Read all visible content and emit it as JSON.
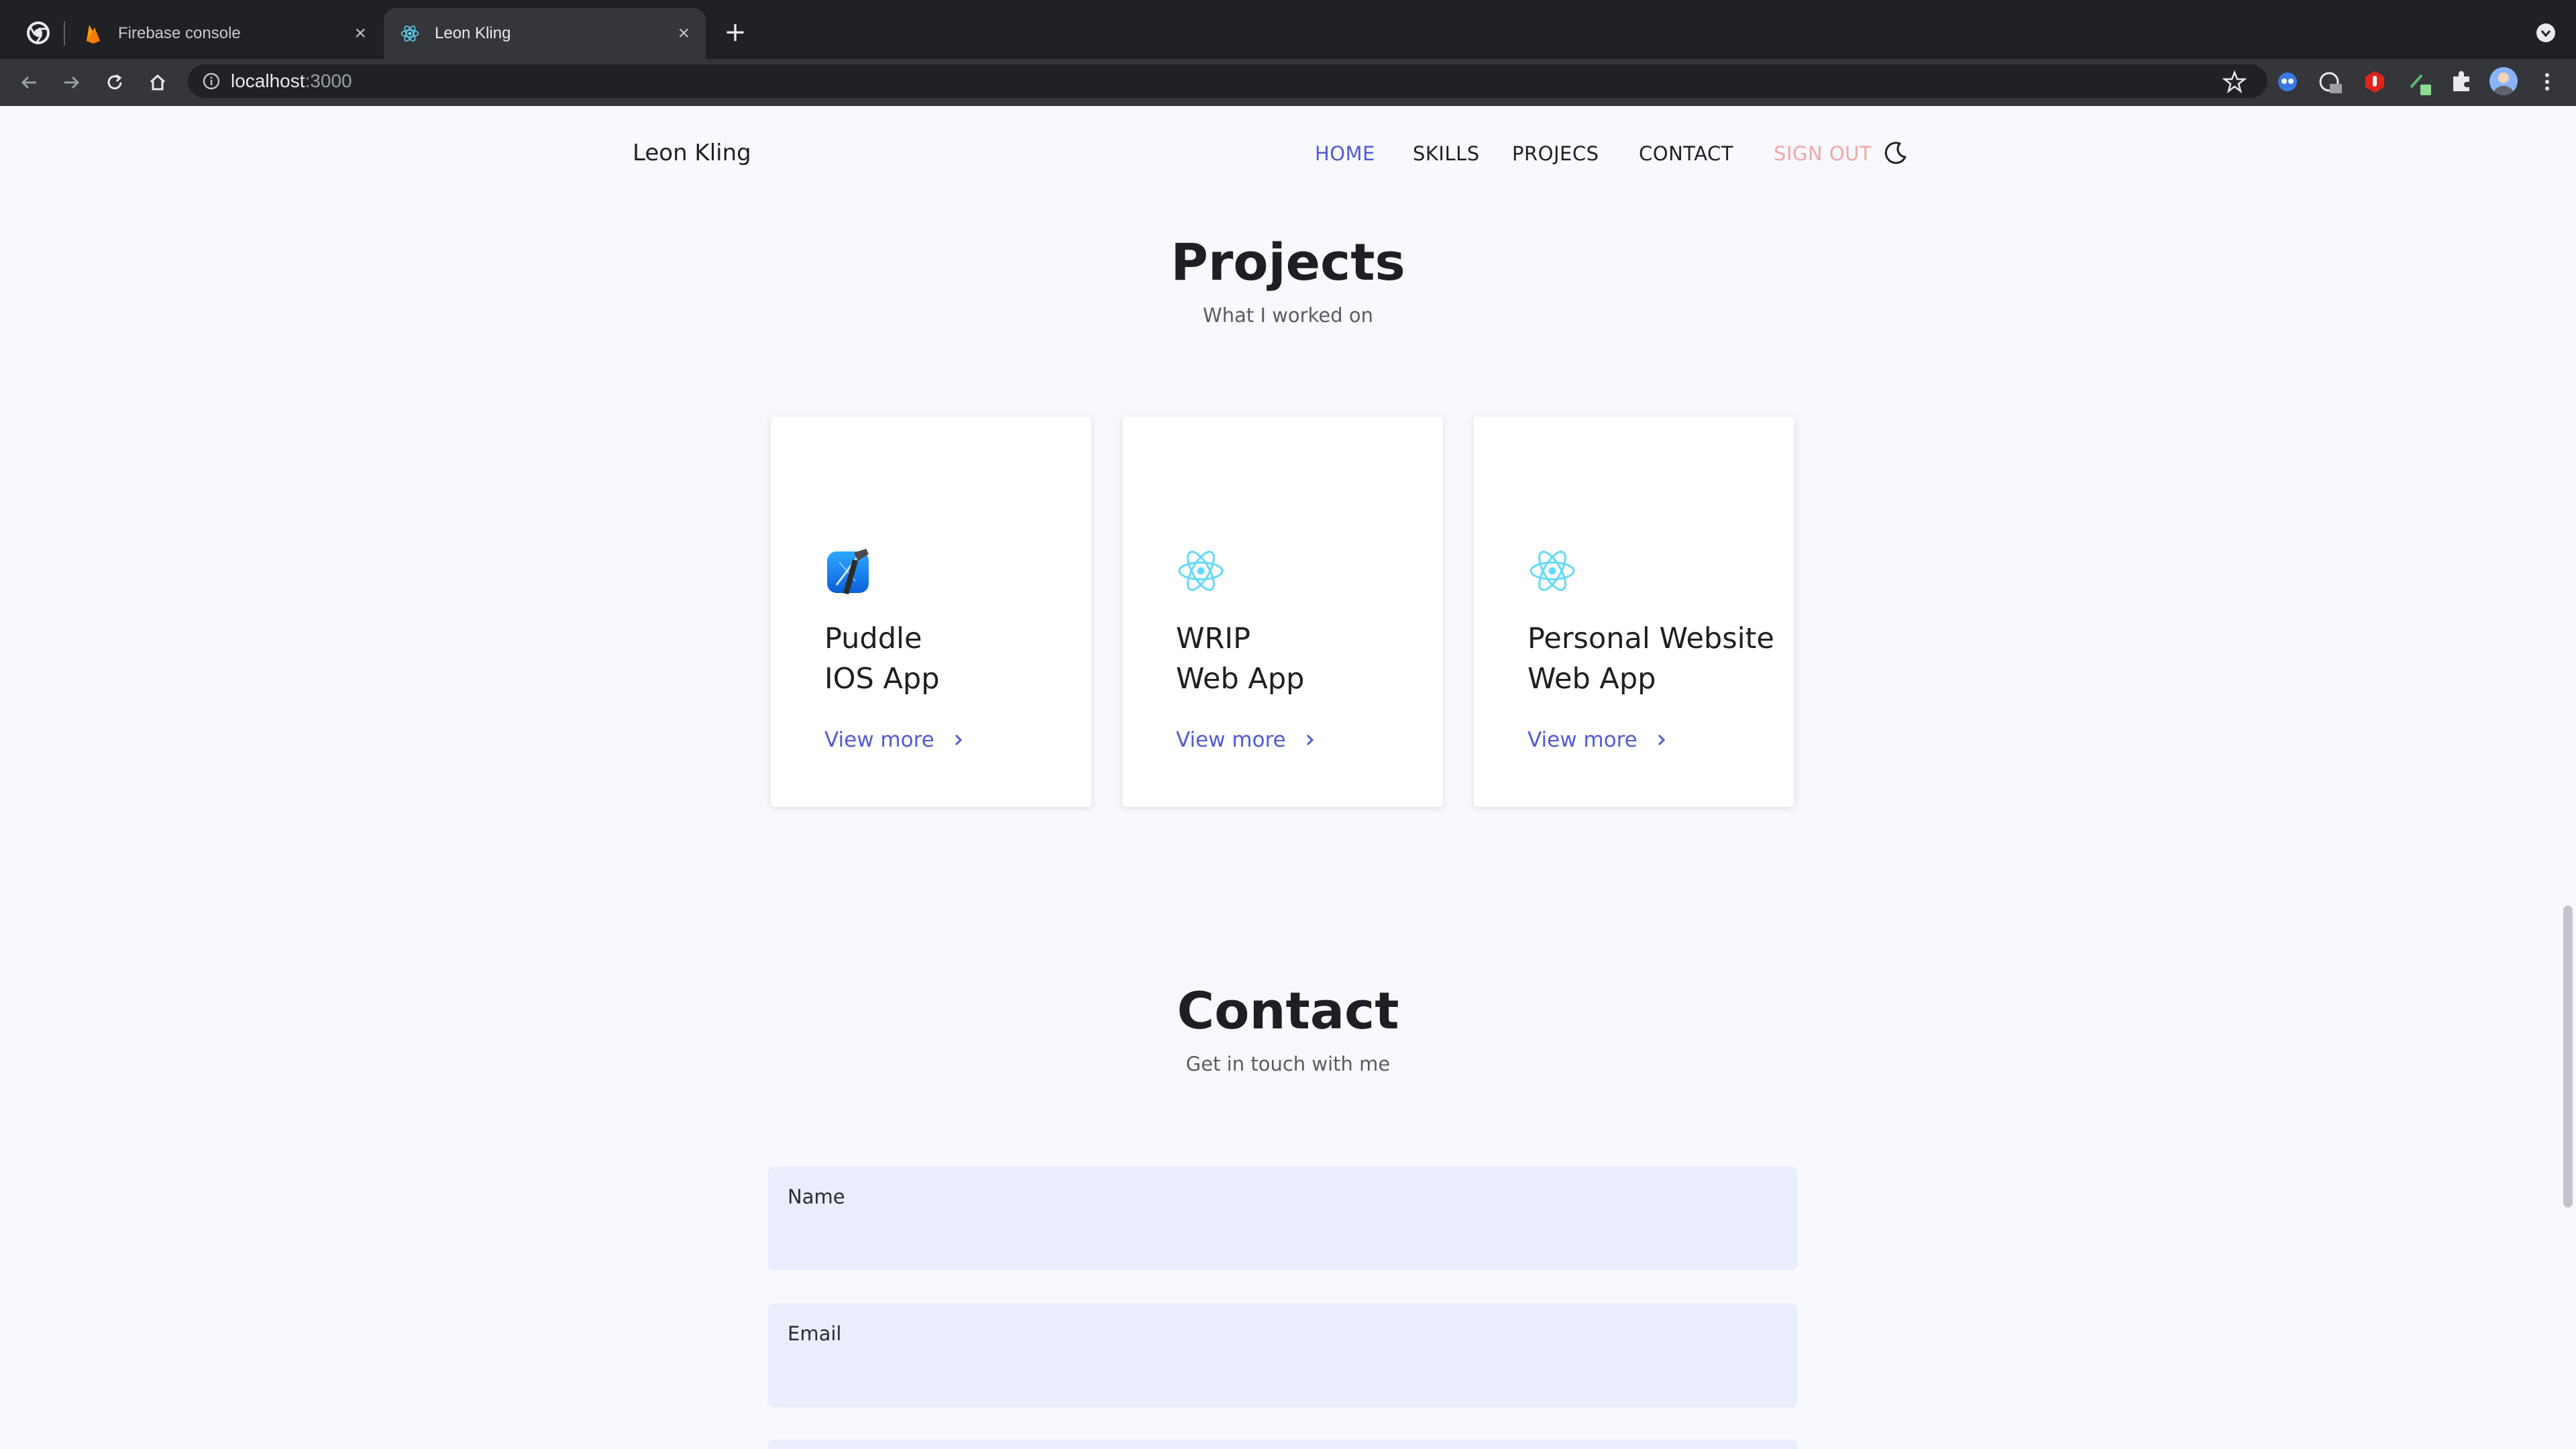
{
  "browser": {
    "tabs": [
      {
        "title": "Firebase console",
        "active": false,
        "icon": "firebase-icon"
      },
      {
        "title": "Leon Kling",
        "active": true,
        "icon": "react-icon"
      }
    ],
    "url_host": "localhost",
    "url_port": ":3000"
  },
  "nav": {
    "brand": "Leon Kling",
    "links": [
      "HOME",
      "SKILLS",
      "PROJECS",
      "CONTACT",
      "SIGN OUT"
    ],
    "theme_icon": "moon-icon"
  },
  "projects": {
    "title": "Projects",
    "subtitle": "What I worked on",
    "cards": [
      {
        "line1": "Puddle",
        "line2": "IOS App",
        "icon": "xcode-icon",
        "link": "View more"
      },
      {
        "line1": "WRIP",
        "line2": "Web App",
        "icon": "react-icon",
        "link": "View more"
      },
      {
        "line1": "Personal Website",
        "line2": "Web App",
        "icon": "react-icon",
        "link": "View more"
      }
    ]
  },
  "contact": {
    "title": "Contact",
    "subtitle": "Get in touch with me",
    "fields": [
      "Name",
      "Email"
    ]
  },
  "colors": {
    "accent": "#4f5bd5",
    "signout": "#f2a6a3",
    "page_bg": "#f8f9fe",
    "field_bg": "#eaedfc"
  }
}
